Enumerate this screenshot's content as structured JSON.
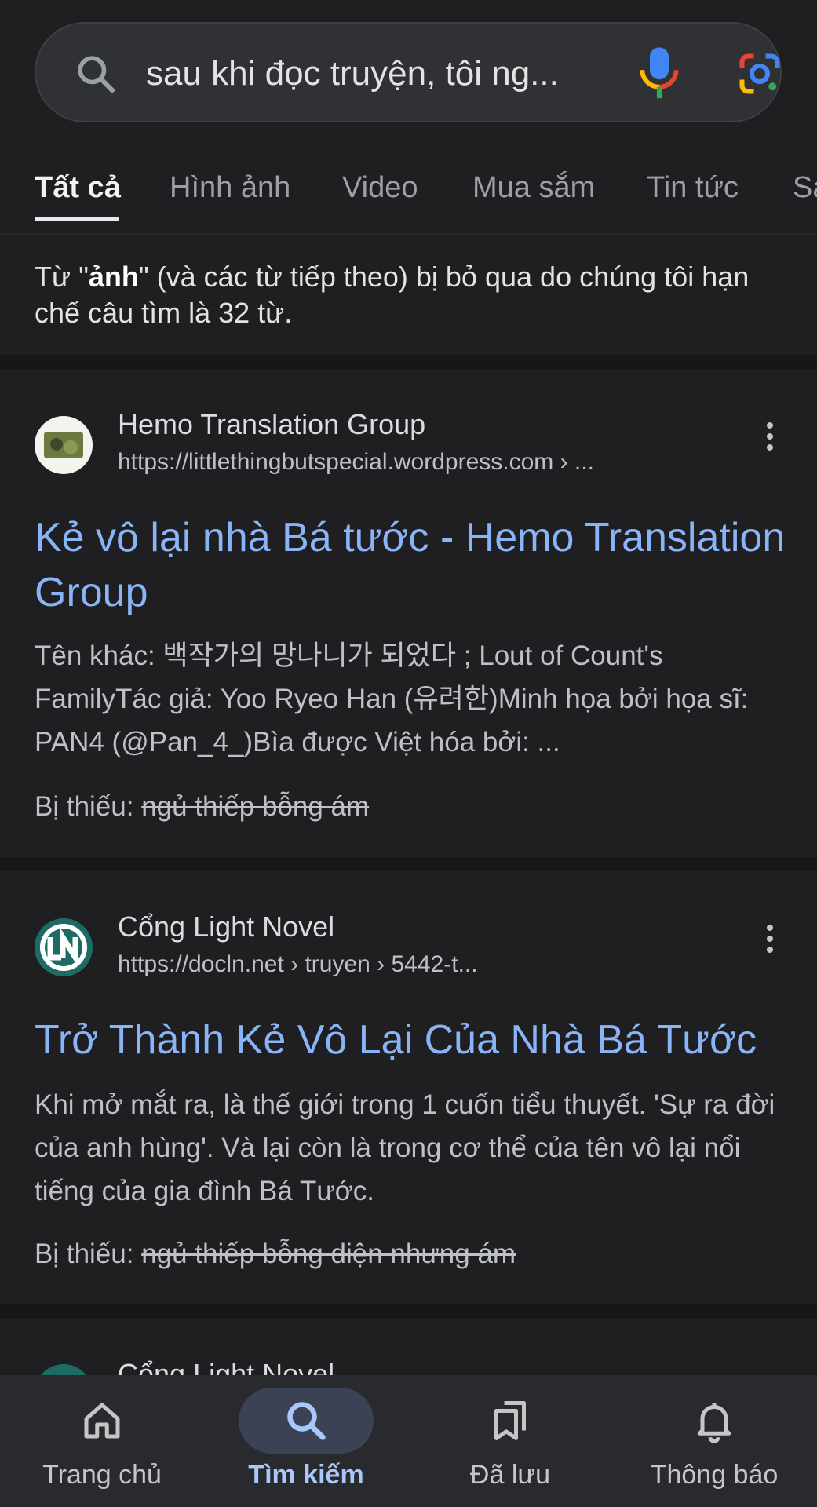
{
  "search": {
    "query": "sau khi đọc truyện, tôi ng..."
  },
  "tabs": [
    {
      "label": "Tất cả",
      "active": true
    },
    {
      "label": "Hình ảnh"
    },
    {
      "label": "Video"
    },
    {
      "label": "Mua sắm"
    },
    {
      "label": "Tin tức"
    },
    {
      "label": "Sá"
    }
  ],
  "notice": {
    "prefix": "Từ \"",
    "word": "ảnh",
    "suffix": "\" (và các từ tiếp theo) bị bỏ qua do chúng tôi hạn chế câu tìm là 32 từ."
  },
  "results": [
    {
      "site_name": "Hemo Translation Group",
      "url": "https://littlethingbutspecial.wordpress.com › ...",
      "title": "Kẻ vô lại nhà Bá tước - Hemo Translation Group",
      "snippet": "Tên khác: 백작가의 망나니가 되었다 ; Lout of Count's FamilyTác giả: Yoo Ryeo Han (유려한)Minh họa bởi họa sĩ: PAN4 (@Pan_4_)Bìa được Việt hóa bởi: ...",
      "missing_label": "Bị thiếu:",
      "missing_terms": "ngủ thiếp bỗng ám"
    },
    {
      "site_name": "Cổng Light Novel",
      "url": "https://docln.net › truyen › 5442-t...",
      "title": "Trở Thành Kẻ Vô Lại Của Nhà Bá Tước",
      "snippet": "Khi mở mắt ra, là thế giới trong 1 cuốn tiểu thuyết. 'Sự ra đời của anh hùng'. Và lại còn là trong cơ thể của tên vô lại nổi tiếng của gia đình Bá Tước.",
      "missing_label": "Bị thiếu:",
      "missing_terms": "ngủ thiếp bỗng diện nhưng ám"
    },
    {
      "site_name": "Cổng Light Novel"
    }
  ],
  "bottom_nav": [
    {
      "label": "Trang chủ",
      "icon": "home-icon"
    },
    {
      "label": "Tìm kiếm",
      "icon": "search-icon",
      "active": true
    },
    {
      "label": "Đã lưu",
      "icon": "bookmarks-icon"
    },
    {
      "label": "Thông báo",
      "icon": "bell-icon"
    }
  ],
  "colors": {
    "background": "#1f1f21",
    "link": "#8ab4f8",
    "active_nav": "#a8c7fa"
  }
}
